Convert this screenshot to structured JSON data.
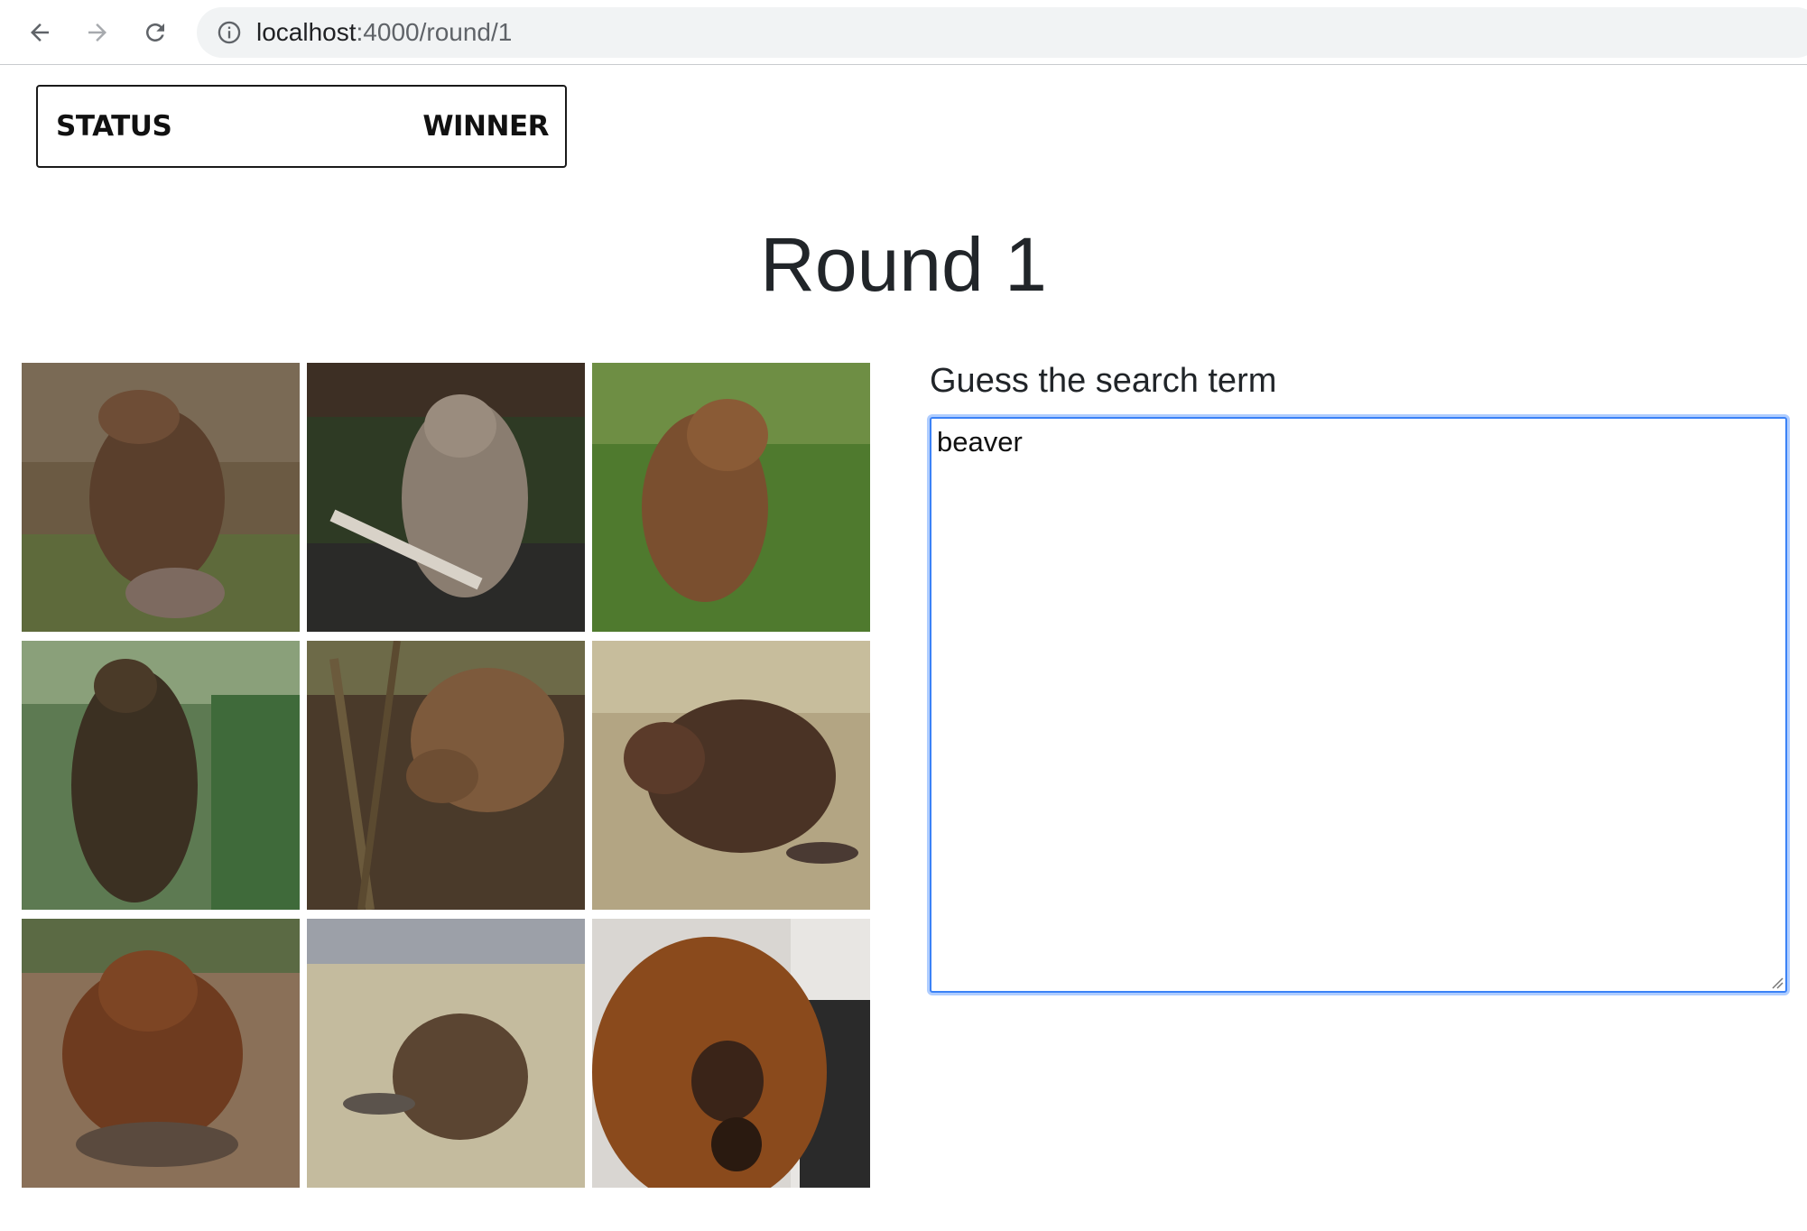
{
  "browser": {
    "url_host": "localhost",
    "url_path": ":4000/round/1",
    "icons": {
      "back": "arrow-left-icon",
      "forward": "arrow-right-icon",
      "reload": "reload-icon",
      "info": "info-icon"
    }
  },
  "status_panel": {
    "status_label": "STATUS",
    "winner_label": "WINNER"
  },
  "round": {
    "title": "Round 1"
  },
  "image_grid": {
    "images": [
      {
        "subject": "beaver",
        "palette": "brown"
      },
      {
        "subject": "beaver",
        "palette": "gray-wet"
      },
      {
        "subject": "beaver",
        "palette": "grass"
      },
      {
        "subject": "beaver",
        "palette": "dark-standing"
      },
      {
        "subject": "beaver",
        "palette": "brush"
      },
      {
        "subject": "beaver",
        "palette": "dirt"
      },
      {
        "subject": "beaver",
        "palette": "red-front"
      },
      {
        "subject": "beaver",
        "palette": "snowy"
      },
      {
        "subject": "beaver",
        "palette": "closeup"
      }
    ]
  },
  "guess": {
    "label": "Guess the search term",
    "value": "beaver"
  },
  "colors": {
    "focus_ring": "#3b82f6",
    "text": "#212529"
  }
}
